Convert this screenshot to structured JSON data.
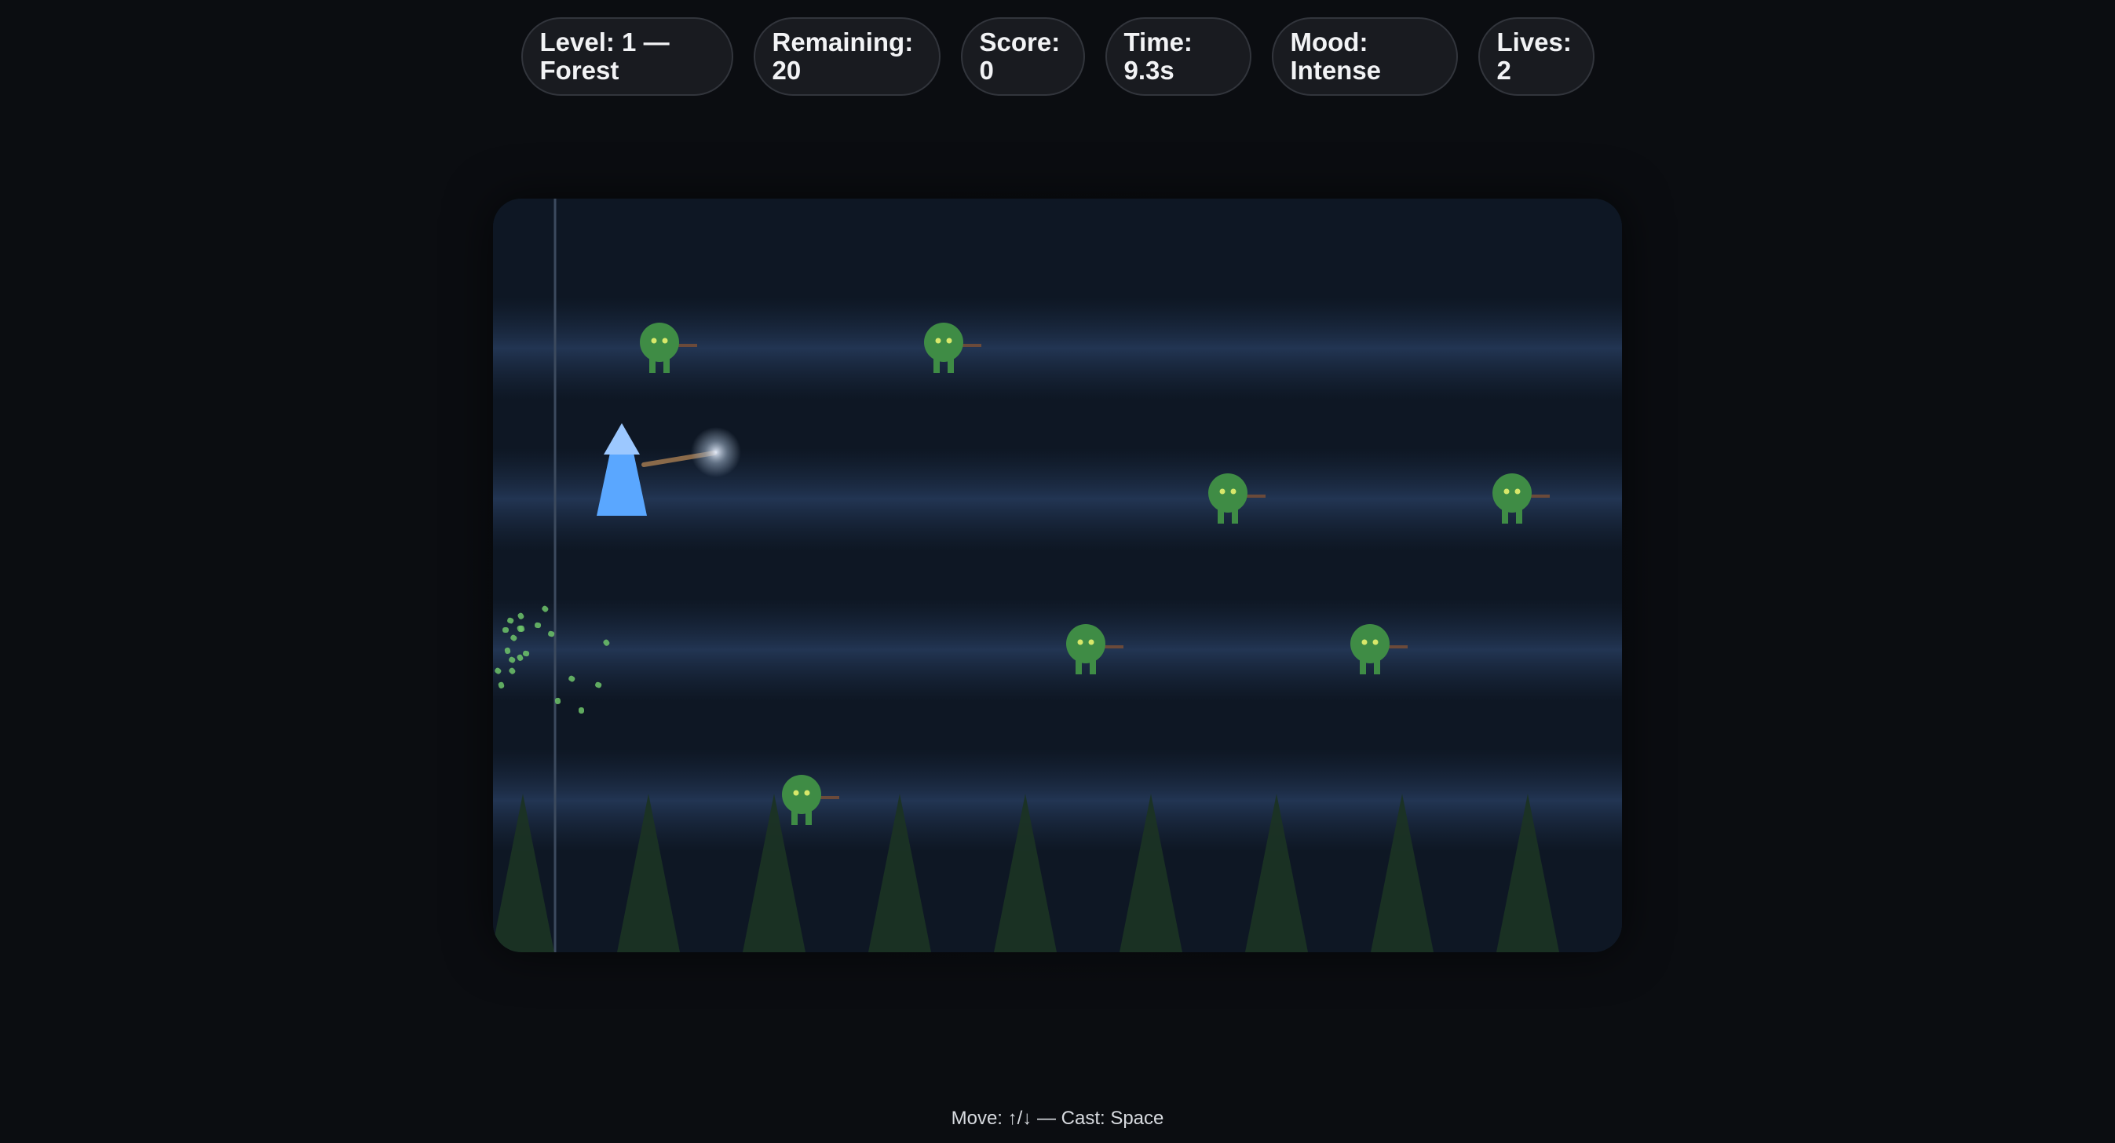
{
  "hud": {
    "level": {
      "label": "Level: 1 —",
      "value": "Forest"
    },
    "remaining": {
      "label": "Remaining:",
      "value": "20"
    },
    "score": {
      "label": "Score:",
      "value": "0"
    },
    "time": {
      "label": "Time:",
      "value": "9.3s"
    },
    "mood": {
      "label": "Mood:",
      "value": "Intense"
    },
    "lives": {
      "label": "Lives:",
      "value": "2"
    }
  },
  "game": {
    "player": {
      "lane": 2,
      "color": "#5aa7ff",
      "hat_color": "#9cc8ff",
      "staff_color": "#8a6a4a"
    },
    "enemy_color": "#3f8c45",
    "enemy_eye_color": "#d8e86a",
    "enemies": [
      {
        "lane": 1,
        "slot": 1
      },
      {
        "lane": 1,
        "slot": 3
      },
      {
        "lane": 2,
        "slot": 5
      },
      {
        "lane": 2,
        "slot": 7
      },
      {
        "lane": 3,
        "slot": 4
      },
      {
        "lane": 3,
        "slot": 6
      },
      {
        "lane": 3,
        "slot": 8
      },
      {
        "lane": 4,
        "slot": 2
      }
    ],
    "tree_count": 9,
    "colors": {
      "background": "#0e1724",
      "lane": "#1b2a40",
      "tree": "#1b3324",
      "particle": "#6ec46a"
    }
  },
  "controls": "Move: ↑/↓ — Cast: Space"
}
